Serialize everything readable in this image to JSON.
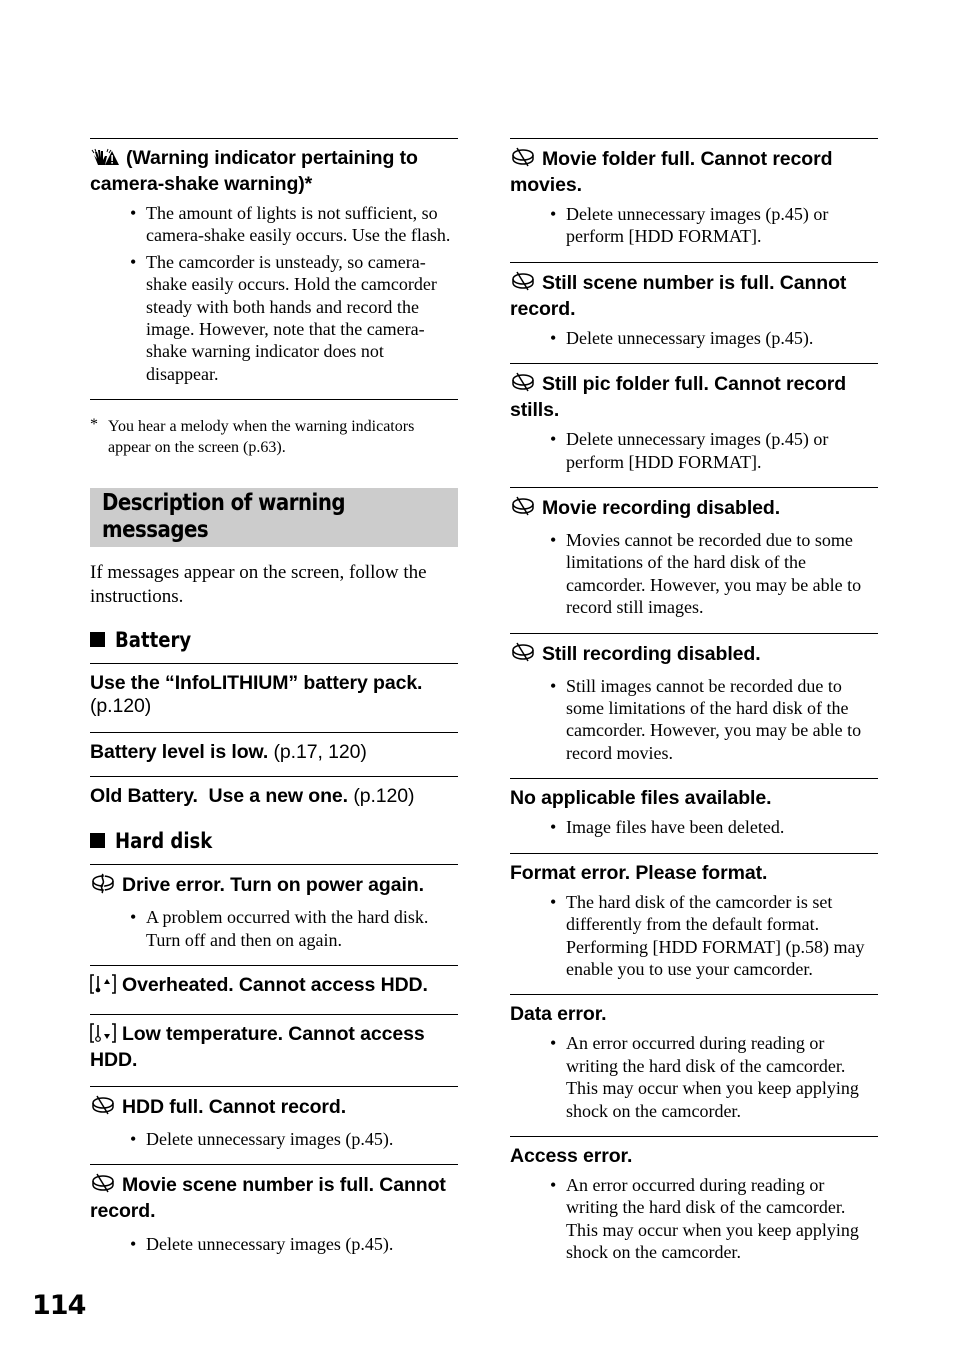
{
  "left_column": {
    "camera_shake": {
      "icon": "camera-shake-warning-icon",
      "title": "(Warning indicator pertaining to camera-shake warning)*",
      "bullets": [
        "The amount of lights is not sufficient, so camera-shake easily occurs. Use the flash.",
        "The camcorder is unsteady, so camera-shake easily occurs. Hold the camcorder steady with both hands and record the image. However, note that the camera-shake warning indicator does not disappear."
      ]
    },
    "footnote": {
      "marker": "*",
      "text": "You hear a melody when the warning indicators appear on the screen (p.63)."
    },
    "section_title_line1": "Description of warning",
    "section_title_line2": "messages",
    "intro": "If messages appear on the screen, follow the instructions.",
    "battery": {
      "heading": "Battery",
      "entries": [
        {
          "title": "Use the “InfoLITHIUM” battery pack.",
          "ref": "(p.120)"
        },
        {
          "title": "Battery level is low.",
          "ref": "(p.17, 120)"
        },
        {
          "title": "Old Battery.  Use a new one.",
          "ref": "(p.120)"
        }
      ]
    },
    "hard_disk": {
      "heading": "Hard disk",
      "entries": [
        {
          "icon": "drive-error-icon",
          "title": "Drive error. Turn on power again.",
          "bullets": [
            "A problem occurred with the hard disk. Turn off and then on again."
          ]
        },
        {
          "icon": "overheat-icon",
          "title": "Overheated. Cannot access HDD.",
          "bullets": []
        },
        {
          "icon": "low-temperature-icon",
          "title": "Low temperature. Cannot access HDD.",
          "bullets": []
        },
        {
          "icon": "hdd-full-icon",
          "title": "HDD full. Cannot record.",
          "bullets": [
            "Delete unnecessary images (p.45)."
          ]
        },
        {
          "icon": "hdd-full-icon",
          "title": "Movie scene number is full. Cannot record.",
          "bullets": [
            "Delete unnecessary images (p.45)."
          ]
        }
      ]
    }
  },
  "right_column": {
    "entries": [
      {
        "icon": "hdd-full-icon",
        "title": "Movie folder full. Cannot record movies.",
        "bullets": [
          "Delete unnecessary images (p.45) or perform [HDD FORMAT]."
        ]
      },
      {
        "icon": "hdd-full-icon",
        "title": "Still scene number is full. Cannot record.",
        "bullets": [
          "Delete unnecessary images (p.45)."
        ]
      },
      {
        "icon": "hdd-full-icon",
        "title": "Still pic folder full. Cannot record stills.",
        "bullets": [
          "Delete unnecessary images (p.45) or perform [HDD FORMAT]."
        ]
      },
      {
        "icon": "hdd-full-icon",
        "title": "Movie recording disabled.",
        "bullets": [
          "Movies cannot be recorded due to some limitations of the hard disk of the camcorder. However, you may be able to record still images."
        ]
      },
      {
        "icon": "hdd-full-icon",
        "title": "Still recording disabled.",
        "bullets": [
          "Still images cannot be recorded due to some limitations of the hard disk of the camcorder. However, you may be able to record movies."
        ]
      },
      {
        "title": "No applicable files available.",
        "bullets": [
          "Image files have been deleted."
        ]
      },
      {
        "title": "Format error. Please format.",
        "bullets": [
          "The hard disk of the camcorder is set differently from the default format. Performing [HDD FORMAT] (p.58) may enable you to use your camcorder."
        ]
      },
      {
        "title": "Data error.",
        "bullets": [
          "An error occurred during reading or writing the hard disk of the camcorder. This may occur when you keep applying shock on the camcorder."
        ]
      },
      {
        "title": "Access error.",
        "bullets": [
          "An error occurred during reading or writing the hard disk of the camcorder. This may occur when you keep applying shock on the camcorder."
        ]
      }
    ]
  },
  "page_number": "114"
}
